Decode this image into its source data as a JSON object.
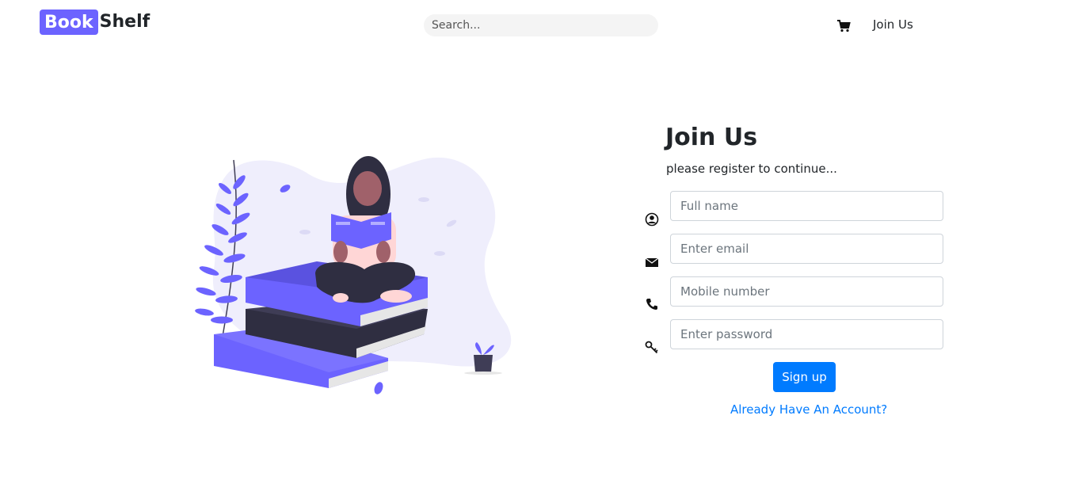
{
  "header": {
    "logo_part1": "Book",
    "logo_part2": "Shelf",
    "search_placeholder": "Search...",
    "cart_icon": "shopping-cart-icon",
    "nav_join_label": "Join Us"
  },
  "form": {
    "title": "Join Us",
    "subtitle": "please register to continue...",
    "fields": [
      {
        "icon": "user-circle-icon",
        "placeholder": "Full name"
      },
      {
        "icon": "envelope-icon",
        "placeholder": "Enter email"
      },
      {
        "icon": "phone-icon",
        "placeholder": "Mobile number"
      },
      {
        "icon": "key-icon",
        "placeholder": "Enter password"
      }
    ],
    "submit_label": "Sign up",
    "login_link": "Already Have An Account?"
  },
  "colors": {
    "brand": "#6c63ff",
    "primary": "#007bff"
  }
}
